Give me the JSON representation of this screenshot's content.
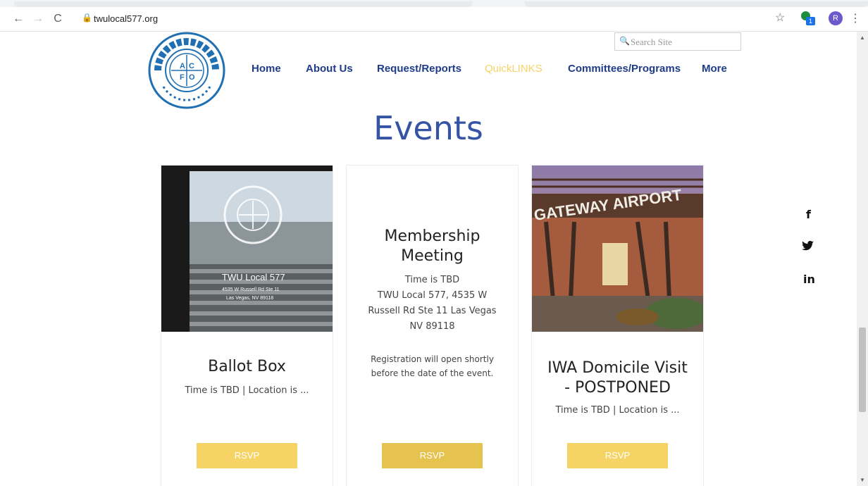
{
  "browser": {
    "url": "twulocal577.org",
    "back_icon": "back-arrow-icon",
    "forward_icon": "forward-arrow-icon",
    "reload_icon": "reload-icon",
    "lock_icon": "lock-icon",
    "profile_initial": "R"
  },
  "site": {
    "search_placeholder": "Search Site",
    "nav": [
      {
        "label": "Home"
      },
      {
        "label": "About Us"
      },
      {
        "label": "Request/Reports"
      },
      {
        "label": "QuickLINKS"
      },
      {
        "label": "Committees/Programs"
      },
      {
        "label": "More"
      }
    ],
    "colors": {
      "nav": "#1f3c88",
      "quicklinks": "#f6d365",
      "heading": "#3554a5",
      "rsvp": "#f6d365",
      "rsvp_hover": "#e6c24e"
    }
  },
  "events": {
    "heading": "Events",
    "cards": [
      {
        "title": "Ballot Box",
        "meta": "Time is TBD  |  Location is ...",
        "rsvp": "RSVP"
      },
      {
        "title_line1": "Membership",
        "title_line2": "Meeting",
        "time": "Time is TBD",
        "address_line1": "TWU Local 577, 4535 W",
        "address_line2": "Russell Rd Ste 11 Las Vegas",
        "address_line3": "NV 89118",
        "registration_line1": "Registration will open shortly",
        "registration_line2": "before the date of the event.",
        "rsvp": "RSVP"
      },
      {
        "title_line1": "IWA Domicile Visit",
        "title_line2": "- POSTPONED",
        "meta": "Time is TBD  |  Location is ...",
        "rsvp": "RSVP"
      }
    ]
  },
  "photos": {
    "door_sign_line1": "TWU Local 577",
    "door_sign_line2": "4535 W Russell Rd Ste 11",
    "door_sign_line3": "Las Vegas, NV 89118",
    "airport_sign": "GATEWAY AIRPORT"
  },
  "social": {
    "facebook": "f",
    "twitter": "twitter-icon",
    "linkedin": "in"
  }
}
